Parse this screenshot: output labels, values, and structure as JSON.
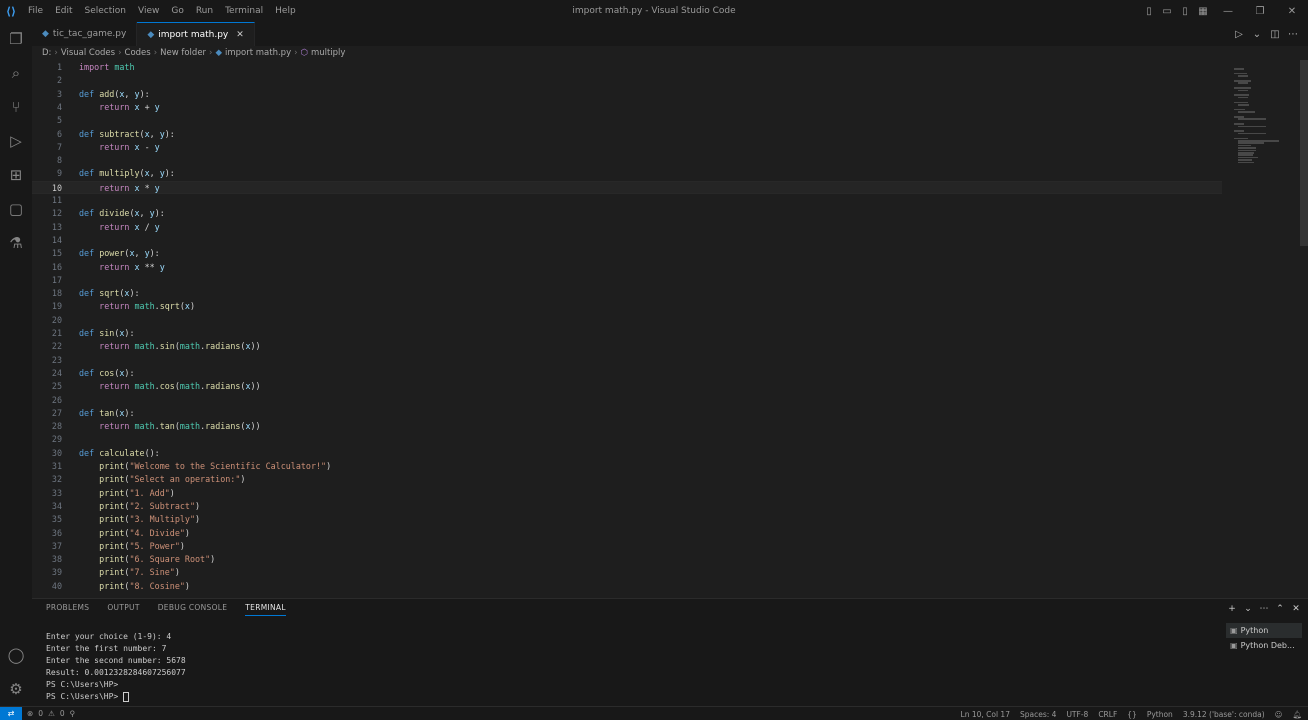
{
  "window": {
    "title": "import math.py - Visual Studio Code"
  },
  "menu": [
    "File",
    "Edit",
    "Selection",
    "View",
    "Go",
    "Run",
    "Terminal",
    "Help"
  ],
  "tabs": [
    {
      "label": "tic_tac_game.py",
      "active": false
    },
    {
      "label": "import math.py",
      "active": true
    }
  ],
  "breadcrumb": [
    "D:",
    "Visual Codes",
    "Codes",
    "New folder",
    "import math.py",
    "multiply"
  ],
  "editor": {
    "current_line": 10,
    "lines": [
      {
        "n": "1",
        "code": "import math"
      },
      {
        "n": "2",
        "code": ""
      },
      {
        "n": "3",
        "code": "def add(x, y):"
      },
      {
        "n": "4",
        "code": "    return x + y"
      },
      {
        "n": "5",
        "code": ""
      },
      {
        "n": "6",
        "code": "def subtract(x, y):"
      },
      {
        "n": "7",
        "code": "    return x - y"
      },
      {
        "n": "8",
        "code": ""
      },
      {
        "n": "9",
        "code": "def multiply(x, y):"
      },
      {
        "n": "10",
        "code": "    return x * y"
      },
      {
        "n": "11",
        "code": ""
      },
      {
        "n": "12",
        "code": "def divide(x, y):"
      },
      {
        "n": "13",
        "code": "    return x / y"
      },
      {
        "n": "14",
        "code": ""
      },
      {
        "n": "15",
        "code": "def power(x, y):"
      },
      {
        "n": "16",
        "code": "    return x ** y"
      },
      {
        "n": "17",
        "code": ""
      },
      {
        "n": "18",
        "code": "def sqrt(x):"
      },
      {
        "n": "19",
        "code": "    return math.sqrt(x)"
      },
      {
        "n": "20",
        "code": ""
      },
      {
        "n": "21",
        "code": "def sin(x):"
      },
      {
        "n": "22",
        "code": "    return math.sin(math.radians(x))"
      },
      {
        "n": "23",
        "code": ""
      },
      {
        "n": "24",
        "code": "def cos(x):"
      },
      {
        "n": "25",
        "code": "    return math.cos(math.radians(x))"
      },
      {
        "n": "26",
        "code": ""
      },
      {
        "n": "27",
        "code": "def tan(x):"
      },
      {
        "n": "28",
        "code": "    return math.tan(math.radians(x))"
      },
      {
        "n": "29",
        "code": ""
      },
      {
        "n": "30",
        "code": "def calculate():"
      },
      {
        "n": "31",
        "code": "    print(\"Welcome to the Scientific Calculator!\")"
      },
      {
        "n": "32",
        "code": "    print(\"Select an operation:\")"
      },
      {
        "n": "33",
        "code": "    print(\"1. Add\")"
      },
      {
        "n": "34",
        "code": "    print(\"2. Subtract\")"
      },
      {
        "n": "35",
        "code": "    print(\"3. Multiply\")"
      },
      {
        "n": "36",
        "code": "    print(\"4. Divide\")"
      },
      {
        "n": "37",
        "code": "    print(\"5. Power\")"
      },
      {
        "n": "38",
        "code": "    print(\"6. Square Root\")"
      },
      {
        "n": "39",
        "code": "    print(\"7. Sine\")"
      },
      {
        "n": "40",
        "code": "    print(\"8. Cosine\")"
      }
    ]
  },
  "panel": {
    "tabs": [
      "PROBLEMS",
      "OUTPUT",
      "DEBUG CONSOLE",
      "TERMINAL"
    ],
    "active_tab": "TERMINAL",
    "terminal_lines": [
      "Enter your choice (1-9): 4",
      "Enter the first number: 7",
      "Enter the second number: 5678",
      "Result: 0.0012328284607256077",
      "PS C:\\Users\\HP>",
      "PS C:\\Users\\HP> "
    ],
    "terminals": [
      "Python",
      "Python Deb..."
    ]
  },
  "status": {
    "errors": "0",
    "warnings": "0",
    "position": "Ln 10, Col 17",
    "spaces": "Spaces: 4",
    "encoding": "UTF-8",
    "eol": "CRLF",
    "language": "Python",
    "interpreter": "3.9.12 ('base': conda)"
  },
  "colors": {
    "accent": "#0078d4",
    "background": "#1e1e1e",
    "chrome": "#181818"
  }
}
